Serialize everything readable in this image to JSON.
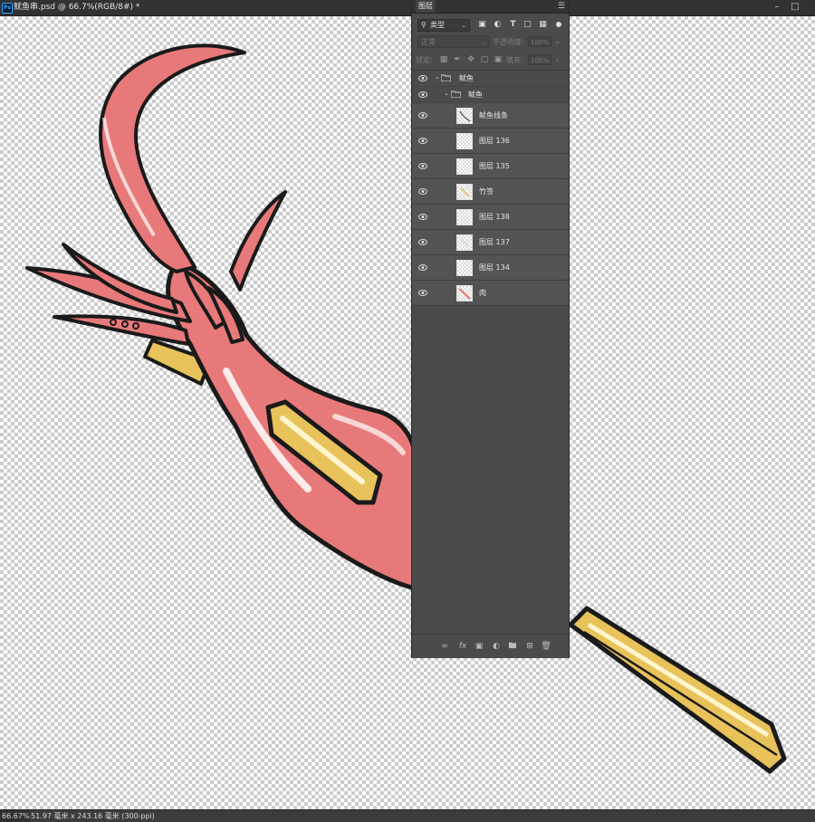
{
  "window": {
    "title": "鱿鱼串.psd @ 66.7%(RGB/8#) *",
    "app_icon": "ps-icon",
    "minimize_icon": "minimize-icon",
    "maximize_icon": "maximize-icon"
  },
  "layers_panel": {
    "tab_label": "图层",
    "menu_icon": "panel-menu-icon",
    "filter": {
      "kind_label": "类型",
      "icons": [
        "image-filter-icon",
        "adjustment-filter-icon",
        "type-filter-icon",
        "shape-filter-icon",
        "smartobject-filter-icon"
      ]
    },
    "blend_mode": "正常",
    "opacity_label": "不透明度:",
    "opacity_value": "100%",
    "lock_label": "锁定:",
    "fill_label": "填充:",
    "fill_value": "100%",
    "layers": [
      {
        "name": "鱿鱼",
        "type": "group",
        "level": 0,
        "visible": true
      },
      {
        "name": "鱿鱼",
        "type": "group",
        "level": 1,
        "visible": true
      },
      {
        "name": "鱿鱼线条",
        "type": "layer",
        "visible": true
      },
      {
        "name": "图层 136",
        "type": "layer",
        "visible": true
      },
      {
        "name": "图层 135",
        "type": "layer",
        "visible": true
      },
      {
        "name": "竹签",
        "type": "layer",
        "visible": true
      },
      {
        "name": "图层 138",
        "type": "layer",
        "visible": true
      },
      {
        "name": "图层 137",
        "type": "layer",
        "visible": true
      },
      {
        "name": "图层 134",
        "type": "layer",
        "visible": true
      },
      {
        "name": "肉",
        "type": "layer",
        "visible": true
      }
    ],
    "footer_icons": [
      "link-layers-icon",
      "fx-icon",
      "add-mask-icon",
      "adjustment-layer-icon",
      "new-group-icon",
      "new-layer-icon",
      "delete-layer-icon"
    ]
  },
  "status_bar": {
    "zoom": "66.67%",
    "doc_info": "51.97 毫米 x 243.16 毫米 (300 ppi)"
  },
  "colors": {
    "squid_body": "#e8797a",
    "skewer": "#e8c25a",
    "outline": "#1a1a1a"
  }
}
